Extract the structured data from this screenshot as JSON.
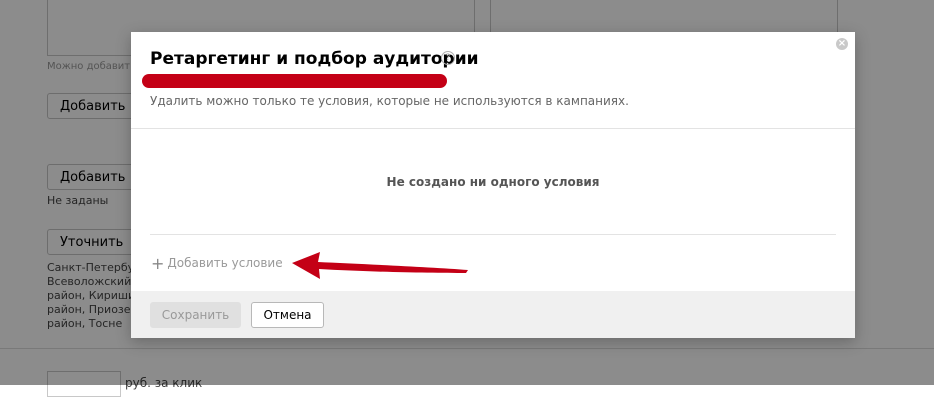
{
  "background": {
    "hint_text": "Можно добавить",
    "add_button_1": "Добавить",
    "add_button_2": "Добавить",
    "not_set_text": "Не заданы",
    "refine_button": "Уточнить",
    "region_lines": [
      "Санкт-Петербург,",
      "Всеволожский",
      "район, Кириши",
      "район, Приозер",
      "район, Тосне"
    ],
    "rub_per_click": "руб. за клик"
  },
  "modal": {
    "title": "Ретаргетинг и подбор аудитории",
    "help_icon": "?",
    "close_icon": "×",
    "subtitle": "Удалить можно только те условия, которые не используются в кампаниях.",
    "empty_state": "Не создано ни одного условия",
    "add_condition_icon": "+",
    "add_condition": "Добавить условие",
    "save_button": "Сохранить",
    "cancel_button": "Отмена"
  },
  "colors": {
    "annotation": "#c40016",
    "overlay": "rgba(0,0,0,0.45)",
    "footer": "#f0f0f0"
  }
}
